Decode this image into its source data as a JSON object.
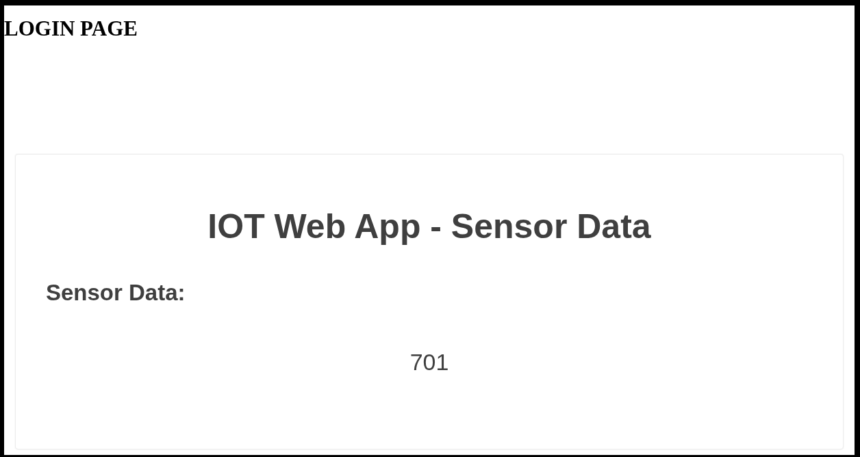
{
  "page_title": "LOGIN PAGE",
  "card": {
    "title": "IOT Web App - Sensor Data",
    "label": "Sensor Data:",
    "value": "701"
  }
}
